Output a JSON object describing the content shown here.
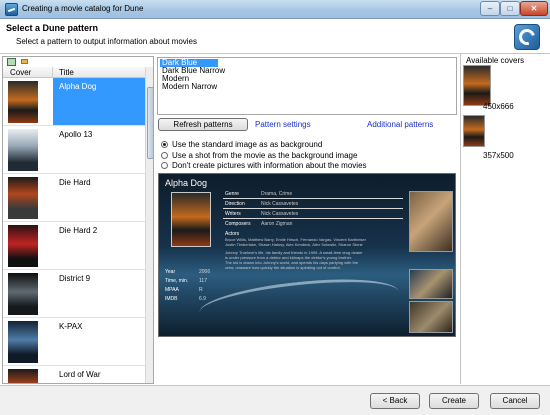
{
  "window": {
    "title": "Creating a movie catalog for Dune",
    "minimize_label": "–",
    "maximize_label": "□",
    "close_label": "✕"
  },
  "header": {
    "title": "Select a Dune pattern",
    "subtitle": "Select a pattern to output information about movies"
  },
  "movie_list": {
    "columns": [
      "Cover",
      "Title"
    ],
    "rows": [
      {
        "title": "Alpha Dog",
        "selected": true
      },
      {
        "title": "Apollo 13",
        "selected": false
      },
      {
        "title": "Die Hard",
        "selected": false
      },
      {
        "title": "Die Hard 2",
        "selected": false
      },
      {
        "title": "District 9",
        "selected": false
      },
      {
        "title": "K-PAX",
        "selected": false
      },
      {
        "title": "Lord of War",
        "selected": false
      }
    ]
  },
  "patterns": {
    "items": [
      "Dark Blue",
      "Dark Blue Narrow",
      "Modern",
      "Modern Narrow"
    ],
    "selected": "Dark Blue"
  },
  "actions": {
    "refresh": "Refresh patterns",
    "settings": "Pattern settings",
    "additional": "Additional patterns"
  },
  "background_options": [
    {
      "label": "Use the standard image as as background",
      "checked": true
    },
    {
      "label": "Use a shot from the movie as the background image",
      "checked": false
    },
    {
      "label": "Don't create pictures with information about the movies",
      "checked": false
    }
  ],
  "preview": {
    "title": "Alpha Dog",
    "stats": [
      {
        "label": "Year",
        "value": "2006"
      },
      {
        "label": "Time, min.",
        "value": "117"
      },
      {
        "label": "MPAA",
        "value": "R"
      },
      {
        "label": "IMDB",
        "value": "6.9"
      }
    ],
    "details": [
      {
        "label": "Genre",
        "value": "Drama, Crime"
      },
      {
        "label": "Direction",
        "value": "Nick Cassavetes"
      },
      {
        "label": "Writers",
        "value": "Nick Cassavetes"
      },
      {
        "label": "Composers",
        "value": "Aaron Zigman"
      }
    ],
    "actors_label": "Actors",
    "actors_text": "Bruce Willis, Matthew Barry, Emile Hirsch, Fernando Vargas, Vincent Kartheiser",
    "actors_text2": "Justin Timberlake, Shawn Hatosy, Alex Kendrick, Alex Solowitz, Sharon Stone",
    "plot_1": "Johnny Truelove's life, his family and friends in 1999. A small-time drug dealer",
    "plot_2": "is under pressure from a debtor and kidnaps the debtor's young brother.",
    "plot_3": "The kid is drawn into Johnny's world, and spends his days partying with the",
    "plot_4": "crew, unaware how quickly the situation is spiraling out of control."
  },
  "covers": {
    "title": "Available covers",
    "items": [
      {
        "caption": "450x666"
      },
      {
        "caption": "357x500"
      }
    ]
  },
  "footer": {
    "back": "< Back",
    "create": "Create",
    "cancel": "Cancel"
  }
}
